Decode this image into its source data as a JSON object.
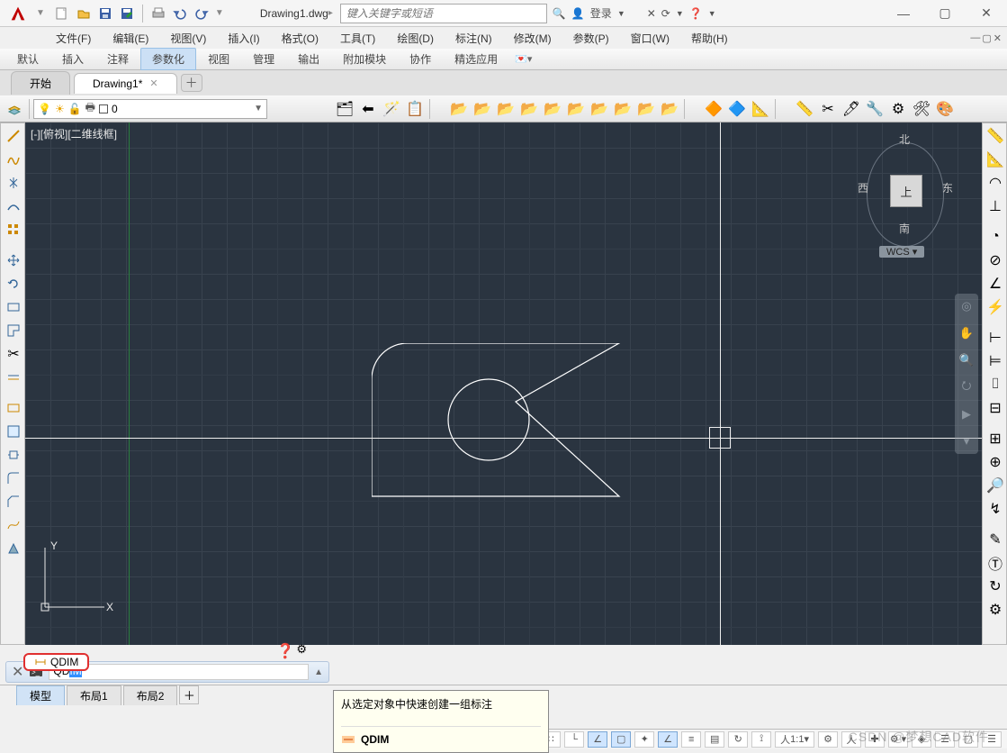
{
  "title": {
    "filename": "Drawing1.dwg",
    "search_placeholder": "键入关键字或短语",
    "login": "登录"
  },
  "menubar": [
    "文件(F)",
    "编辑(E)",
    "视图(V)",
    "插入(I)",
    "格式(O)",
    "工具(T)",
    "绘图(D)",
    "标注(N)",
    "修改(M)",
    "参数(P)",
    "窗口(W)",
    "帮助(H)"
  ],
  "ribbon_tabs": [
    "默认",
    "插入",
    "注释",
    "参数化",
    "视图",
    "管理",
    "输出",
    "附加模块",
    "协作",
    "精选应用"
  ],
  "ribbon_active_index": 3,
  "doc_tabs": [
    {
      "label": "开始",
      "closable": false
    },
    {
      "label": "Drawing1*",
      "closable": true
    }
  ],
  "doc_active_index": 1,
  "layer": {
    "current": "0"
  },
  "viewport_label": "[-][俯视][二维线框]",
  "viewcube": {
    "face": "上",
    "n": "北",
    "s": "南",
    "e": "东",
    "w": "西",
    "wcs": "WCS"
  },
  "ucs": {
    "x": "X",
    "y": "Y"
  },
  "command": {
    "prompt": ">_",
    "typed_prefix": "QD",
    "typed_completion": "IM",
    "suggestion": "QDIM",
    "tooltip_desc": "从选定对象中快速创建一组标注",
    "tooltip_title": "QDIM"
  },
  "layout_tabs": [
    "模型",
    "布局1",
    "布局2"
  ],
  "layout_active_index": 0,
  "status": {
    "scale": "1:1",
    "watermark": "CSDN @梦想CAD软件"
  }
}
